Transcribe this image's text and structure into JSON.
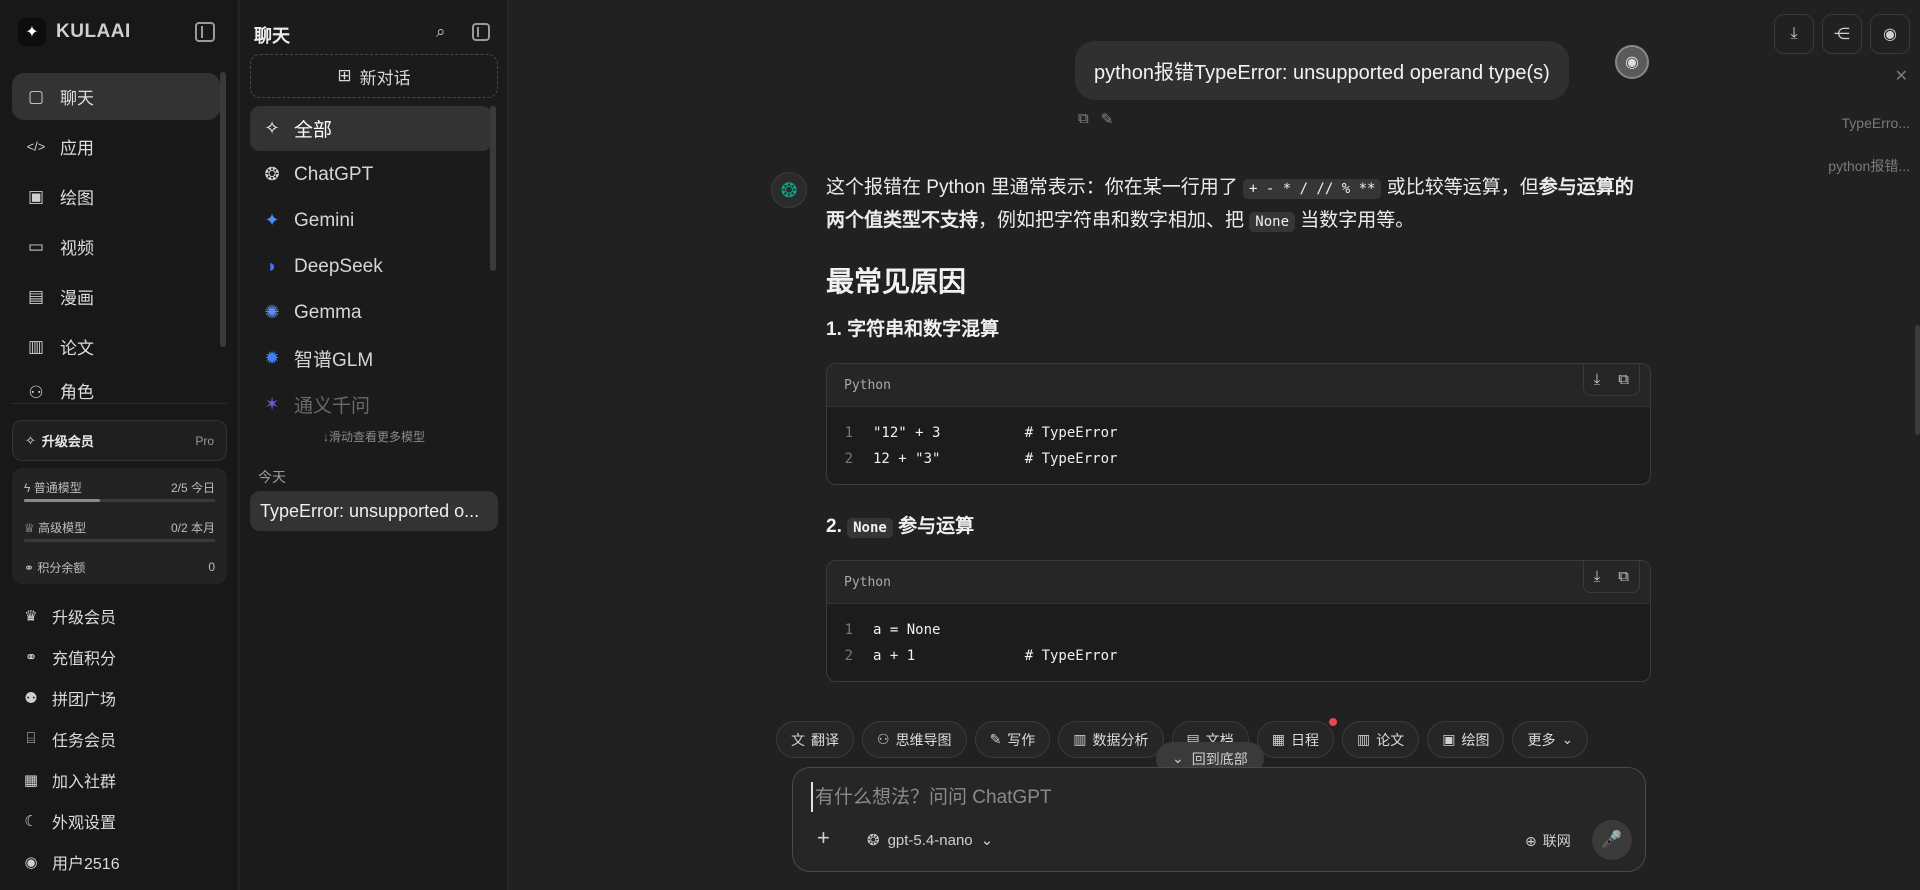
{
  "brand": {
    "name": "KULAAI",
    "logo_glyph": "✦"
  },
  "nav": {
    "items": [
      {
        "label": "聊天",
        "icon": "chat-icon",
        "glyph": "▢"
      },
      {
        "label": "应用",
        "icon": "code-icon",
        "glyph": "</>"
      },
      {
        "label": "绘图",
        "icon": "image-edit-icon",
        "glyph": "▣"
      },
      {
        "label": "视频",
        "icon": "video-icon",
        "glyph": "▭"
      },
      {
        "label": "漫画",
        "icon": "comic-icon",
        "glyph": "▤"
      },
      {
        "label": "论文",
        "icon": "document-icon",
        "glyph": "▥"
      },
      {
        "label": "角色",
        "icon": "role-icon",
        "glyph": "⚇"
      }
    ]
  },
  "upgrade_card": {
    "label": "升级会员",
    "badge": "Pro"
  },
  "quota": {
    "normal": {
      "label": "普通模型",
      "value": "2/5 今日",
      "fraction": 0.4
    },
    "advanced": {
      "label": "高级模型",
      "value": "0/2 本月",
      "fraction": 0
    },
    "points": {
      "label": "积分余额",
      "value": "0"
    }
  },
  "bottom_nav": [
    {
      "label": "升级会员",
      "icon": "crown-icon",
      "glyph": "♛"
    },
    {
      "label": "充值积分",
      "icon": "link-icon",
      "glyph": "⚭"
    },
    {
      "label": "拼团广场",
      "icon": "users-icon",
      "glyph": "⚉"
    },
    {
      "label": "任务会员",
      "icon": "gift-icon",
      "glyph": "⌸"
    },
    {
      "label": "加入社群",
      "icon": "qrcode-icon",
      "glyph": "▦"
    },
    {
      "label": "外观设置",
      "icon": "moon-icon",
      "glyph": "☾"
    },
    {
      "label": "用户2516",
      "icon": "user-icon",
      "glyph": "◉"
    }
  ],
  "chat_panel": {
    "title": "聊天",
    "new_chat": "新对话",
    "models": [
      {
        "label": "全部",
        "icon": "sparkle-icon",
        "glyph": "✧"
      },
      {
        "label": "ChatGPT",
        "icon": "openai-icon",
        "glyph": "❂"
      },
      {
        "label": "Gemini",
        "icon": "gemini-icon",
        "glyph": "✦"
      },
      {
        "label": "DeepSeek",
        "icon": "deepseek-icon",
        "glyph": "◗"
      },
      {
        "label": "Gemma",
        "icon": "gemma-icon",
        "glyph": "✺"
      },
      {
        "label": "智谱GLM",
        "icon": "glm-icon",
        "glyph": "✹"
      },
      {
        "label": "通义千问",
        "icon": "qwen-icon",
        "glyph": "✶"
      }
    ],
    "scroll_hint": "↓滑动查看更多模型",
    "today_label": "今天",
    "history": [
      {
        "title": "TypeError: unsupported o..."
      }
    ]
  },
  "toc": [
    "TypeErro...",
    "python报错..."
  ],
  "conversation": {
    "user_message": "python报错TypeError: unsupported operand type(s)",
    "answer": {
      "p1": {
        "a": "这个报错在 Python 里通常表示：你在某一行用了 ",
        "code1": "+ - * / // % **",
        "b": " 或比较等运算，但",
        "bold": "参与运算的两个值类型不支持",
        "c": "，例如把字符串和数字相加、把 ",
        "code2": "None",
        "d": " 当数字用等。"
      },
      "section_title": "最常见原因",
      "sub1": "1. 字符串和数字混算",
      "code_block1": {
        "lang": "Python",
        "lines": [
          {
            "n": "1",
            "code": "\"12\" + 3          # TypeError"
          },
          {
            "n": "2",
            "code": "12 + \"3\"          # TypeError"
          }
        ]
      },
      "sub2": {
        "prefix": "2. ",
        "code": "None",
        "suffix": " 参与运算"
      },
      "code_block2": {
        "lang": "Python",
        "lines": [
          {
            "n": "1",
            "code": "a = None"
          },
          {
            "n": "2",
            "code": "a + 1             # TypeError"
          }
        ]
      }
    }
  },
  "chips": [
    {
      "label": "翻译",
      "icon": "translate-icon",
      "glyph": "文"
    },
    {
      "label": "思维导图",
      "icon": "mindmap-icon",
      "glyph": "⚇"
    },
    {
      "label": "写作",
      "icon": "pen-icon",
      "glyph": "✎"
    },
    {
      "label": "数据分析",
      "icon": "chart-icon",
      "glyph": "▥"
    },
    {
      "label": "文档",
      "icon": "file-icon",
      "glyph": "▤"
    },
    {
      "label": "日程",
      "icon": "calendar-icon",
      "glyph": "▦"
    },
    {
      "label": "论文",
      "icon": "paper-icon",
      "glyph": "▥"
    },
    {
      "label": "绘图",
      "icon": "picture-icon",
      "glyph": "▣"
    },
    {
      "label": "更多",
      "icon": "chevron-down-icon",
      "glyph": "⌄"
    }
  ],
  "back_to_bottom": "回到底部",
  "composer": {
    "placeholder": "有什么想法？问问 ChatGPT",
    "model": "gpt-5.4-nano",
    "web": "联网"
  },
  "colors": {
    "accent": "#10a37f",
    "notify": "#e5484d"
  }
}
